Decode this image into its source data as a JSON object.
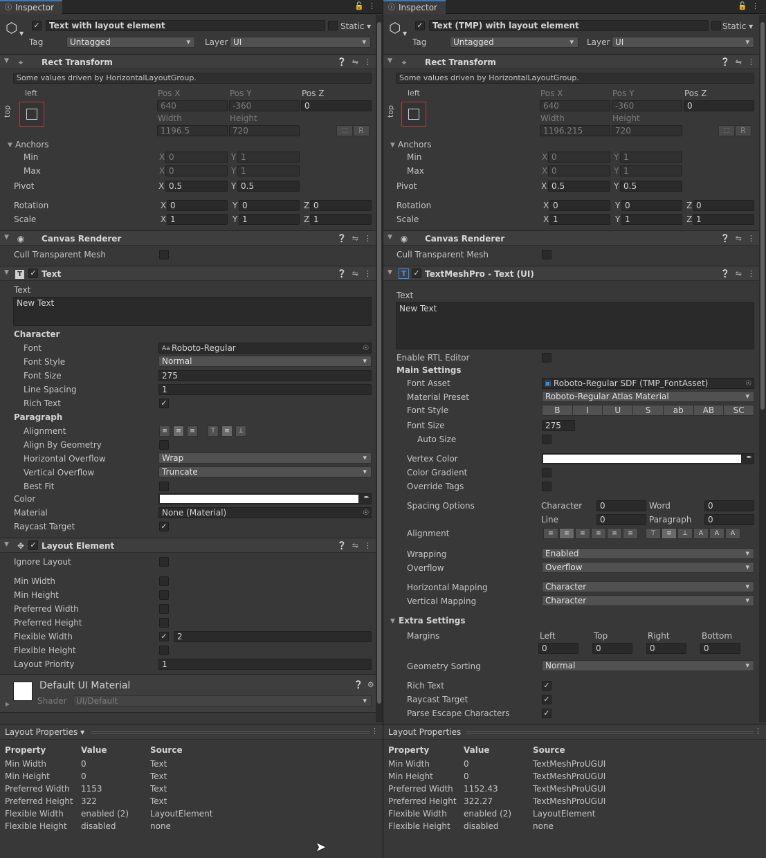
{
  "left": {
    "tab_title": "Inspector",
    "object_name": "Text with layout element",
    "static_label": "Static",
    "tag_label": "Tag",
    "tag_value": "Untagged",
    "layer_label": "Layer",
    "layer_value": "UI",
    "rect": {
      "title": "Rect Transform",
      "help": "Some values driven by HorizontalLayoutGroup.",
      "left_label": "left",
      "top_label": "top",
      "posx_label": "Pos X",
      "posx": "640",
      "posy_label": "Pos Y",
      "posy": "-360",
      "posz_label": "Pos Z",
      "posz": "0",
      "width_label": "Width",
      "width": "1196.5",
      "height_label": "Height",
      "height": "720",
      "r_button": "R",
      "anchors_label": "Anchors",
      "min_label": "Min",
      "min_x": "0",
      "min_y": "1",
      "max_label": "Max",
      "max_x": "0",
      "max_y": "1",
      "pivot_label": "Pivot",
      "pivot_x": "0.5",
      "pivot_y": "0.5",
      "rotation_label": "Rotation",
      "rot_x": "0",
      "rot_y": "0",
      "rot_z": "0",
      "scale_label": "Scale",
      "scale_x": "1",
      "scale_y": "1",
      "scale_z": "1",
      "x": "X",
      "y": "Y",
      "z": "Z"
    },
    "canvas": {
      "title": "Canvas Renderer",
      "cull_label": "Cull Transparent Mesh"
    },
    "text": {
      "title": "Text",
      "text_label": "Text",
      "text_value": "New Text",
      "character_label": "Character",
      "font_label": "Font",
      "font_value": "Roboto-Regular",
      "font_prefix": "Aa",
      "font_style_label": "Font Style",
      "font_style_value": "Normal",
      "font_size_label": "Font Size",
      "font_size_value": "275",
      "line_spacing_label": "Line Spacing",
      "line_spacing_value": "1",
      "rich_text_label": "Rich Text",
      "paragraph_label": "Paragraph",
      "alignment_label": "Alignment",
      "align_geometry_label": "Align By Geometry",
      "h_overflow_label": "Horizontal Overflow",
      "h_overflow_value": "Wrap",
      "v_overflow_label": "Vertical Overflow",
      "v_overflow_value": "Truncate",
      "best_fit_label": "Best Fit",
      "color_label": "Color",
      "material_label": "Material",
      "material_value": "None (Material)",
      "raycast_label": "Raycast Target"
    },
    "layout": {
      "title": "Layout Element",
      "ignore_label": "Ignore Layout",
      "min_width_label": "Min Width",
      "min_height_label": "Min Height",
      "pref_width_label": "Preferred Width",
      "pref_height_label": "Preferred Height",
      "flex_width_label": "Flexible Width",
      "flex_width_value": "2",
      "flex_height_label": "Flexible Height",
      "priority_label": "Layout Priority",
      "priority_value": "1"
    },
    "material": {
      "name": "Default UI Material",
      "shader_label": "Shader",
      "shader_value": "UI/Default"
    },
    "layout_props": {
      "title": "Layout Properties",
      "headers": [
        "Property",
        "Value",
        "Source"
      ],
      "rows": [
        [
          "Min Width",
          "0",
          "Text"
        ],
        [
          "Min Height",
          "0",
          "Text"
        ],
        [
          "Preferred Width",
          "1153",
          "Text"
        ],
        [
          "Preferred Height",
          "322",
          "Text"
        ],
        [
          "Flexible Width",
          "enabled (2)",
          "LayoutElement"
        ],
        [
          "Flexible Height",
          "disabled",
          "none"
        ]
      ]
    }
  },
  "right": {
    "tab_title": "Inspector",
    "object_name": "Text (TMP) with layout element",
    "static_label": "Static",
    "tag_label": "Tag",
    "tag_value": "Untagged",
    "layer_label": "Layer",
    "layer_value": "UI",
    "rect": {
      "title": "Rect Transform",
      "help": "Some values driven by HorizontalLayoutGroup.",
      "left_label": "left",
      "top_label": "top",
      "posx_label": "Pos X",
      "posx": "640",
      "posy_label": "Pos Y",
      "posy": "-360",
      "posz_label": "Pos Z",
      "posz": "0",
      "width_label": "Width",
      "width": "1196.215",
      "height_label": "Height",
      "height": "720",
      "r_button": "R",
      "anchors_label": "Anchors",
      "min_label": "Min",
      "min_x": "0",
      "min_y": "1",
      "max_label": "Max",
      "max_x": "0",
      "max_y": "1",
      "pivot_label": "Pivot",
      "pivot_x": "0.5",
      "pivot_y": "0.5",
      "rotation_label": "Rotation",
      "rot_x": "0",
      "rot_y": "0",
      "rot_z": "0",
      "scale_label": "Scale",
      "scale_x": "1",
      "scale_y": "1",
      "scale_z": "1",
      "x": "X",
      "y": "Y",
      "z": "Z"
    },
    "canvas": {
      "title": "Canvas Renderer",
      "cull_label": "Cull Transparent Mesh"
    },
    "tmp": {
      "title": "TextMeshPro - Text (UI)",
      "text_label": "Text",
      "text_value": "New Text",
      "rtl_label": "Enable RTL Editor",
      "main_settings_label": "Main Settings",
      "font_asset_label": "Font Asset",
      "font_asset_value": "Roboto-Regular SDF (TMP_FontAsset)",
      "material_preset_label": "Material Preset",
      "material_preset_value": "Roboto-Regular Atlas Material",
      "font_style_label": "Font Style",
      "font_style_buttons": [
        "B",
        "I",
        "U",
        "S",
        "ab",
        "AB",
        "SC"
      ],
      "font_size_label": "Font Size",
      "font_size_value": "275",
      "auto_size_label": "Auto Size",
      "vertex_color_label": "Vertex Color",
      "color_gradient_label": "Color Gradient",
      "override_tags_label": "Override Tags",
      "spacing_label": "Spacing Options",
      "sp_character_label": "Character",
      "sp_character_value": "0",
      "sp_word_label": "Word",
      "sp_word_value": "0",
      "sp_line_label": "Line",
      "sp_line_value": "0",
      "sp_paragraph_label": "Paragraph",
      "sp_paragraph_value": "0",
      "alignment_label": "Alignment",
      "wrapping_label": "Wrapping",
      "wrapping_value": "Enabled",
      "overflow_label": "Overflow",
      "overflow_value": "Overflow",
      "h_mapping_label": "Horizontal Mapping",
      "h_mapping_value": "Character",
      "v_mapping_label": "Vertical Mapping",
      "v_mapping_value": "Character",
      "extra_label": "Extra Settings",
      "margins_label": "Margins",
      "m_left_label": "Left",
      "m_left": "0",
      "m_top_label": "Top",
      "m_top": "0",
      "m_right_label": "Right",
      "m_right": "0",
      "m_bottom_label": "Bottom",
      "m_bottom": "0",
      "geometry_label": "Geometry Sorting",
      "geometry_value": "Normal",
      "rich_text_label": "Rich Text",
      "raycast_label": "Raycast Target",
      "parse_escape_label": "Parse Escape Characters"
    },
    "layout_props": {
      "title": "Layout Properties",
      "headers": [
        "Property",
        "Value",
        "Source"
      ],
      "rows": [
        [
          "Min Width",
          "0",
          "TextMeshProUGUI"
        ],
        [
          "Min Height",
          "0",
          "TextMeshProUGUI"
        ],
        [
          "Preferred Width",
          "1152.43",
          "TextMeshProUGUI"
        ],
        [
          "Preferred Height",
          "322.27",
          "TextMeshProUGUI"
        ],
        [
          "Flexible Width",
          "enabled (2)",
          "LayoutElement"
        ],
        [
          "Flexible Height",
          "disabled",
          "none"
        ]
      ]
    }
  },
  "icons": {
    "info": "info-icon",
    "lock": "lock-icon",
    "menu": "kebab-menu-icon",
    "gameobject": "cube-icon",
    "rect": "rect-transform-icon",
    "eye": "eye-icon",
    "text": "text-icon",
    "tmp": "tmp-text-icon",
    "layout": "layout-element-icon",
    "help": "help-icon",
    "preset": "preset-icon",
    "picker": "object-picker-icon",
    "eyedropper": "eyedropper-icon",
    "gear": "gear-icon"
  }
}
